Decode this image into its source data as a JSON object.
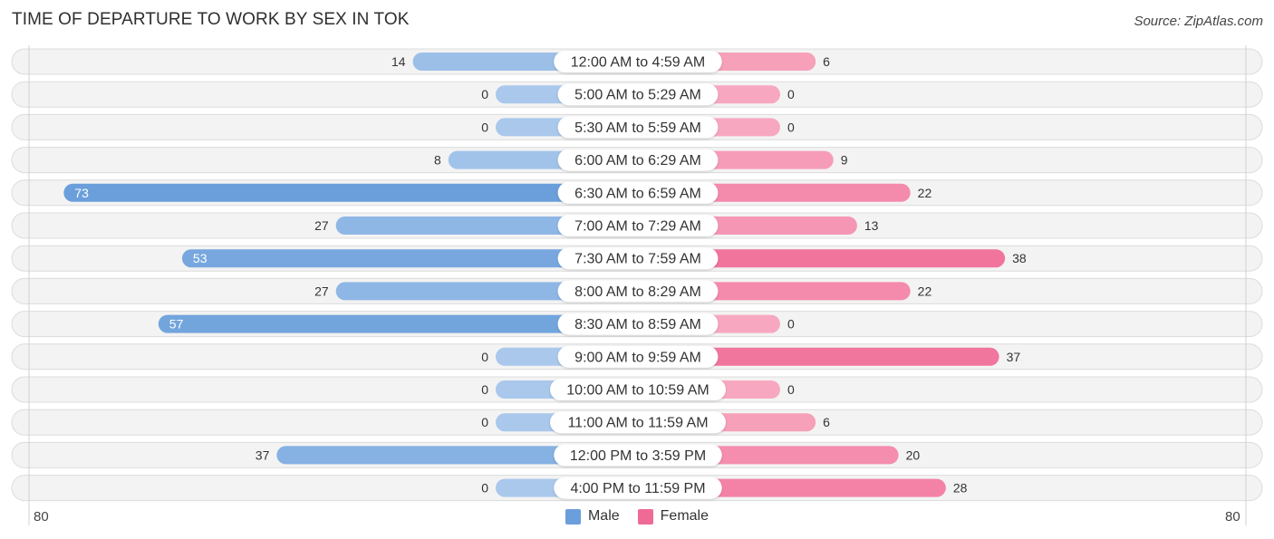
{
  "header": {
    "title": "TIME OF DEPARTURE TO WORK BY SEX IN TOK",
    "source": "Source: ZipAtlas.com"
  },
  "colors": {
    "male": "#6a9fdb",
    "male_light": "#a9c8ec",
    "female": "#f06a96",
    "female_light": "#f7a8c0",
    "row_bg": "#f3f3f3",
    "row_border": "#dcdcdc"
  },
  "legend": {
    "male_label": "Male",
    "female_label": "Female"
  },
  "axis": {
    "left_label": "80",
    "right_label": "80"
  },
  "chart_data": {
    "type": "bar",
    "orientation": "horizontal-diverging",
    "title": "TIME OF DEPARTURE TO WORK BY SEX IN TOK",
    "xlabel": "",
    "ylabel": "",
    "xlim": [
      -80,
      80
    ],
    "legend_position": "bottom-center",
    "categories": [
      "12:00 AM to 4:59 AM",
      "5:00 AM to 5:29 AM",
      "5:30 AM to 5:59 AM",
      "6:00 AM to 6:29 AM",
      "6:30 AM to 6:59 AM",
      "7:00 AM to 7:29 AM",
      "7:30 AM to 7:59 AM",
      "8:00 AM to 8:29 AM",
      "8:30 AM to 8:59 AM",
      "9:00 AM to 9:59 AM",
      "10:00 AM to 10:59 AM",
      "11:00 AM to 11:59 AM",
      "12:00 PM to 3:59 PM",
      "4:00 PM to 11:59 PM"
    ],
    "series": [
      {
        "name": "Male",
        "values": [
          14,
          0,
          0,
          8,
          73,
          27,
          53,
          27,
          57,
          0,
          0,
          0,
          37,
          0
        ]
      },
      {
        "name": "Female",
        "values": [
          6,
          0,
          0,
          9,
          22,
          13,
          38,
          22,
          0,
          37,
          0,
          6,
          20,
          28
        ]
      }
    ]
  }
}
